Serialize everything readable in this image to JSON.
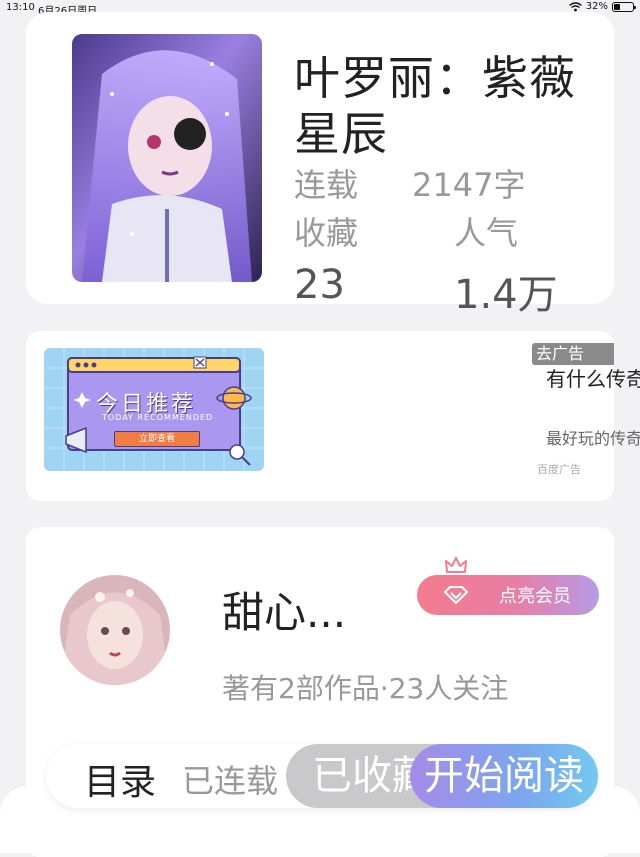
{
  "status_bar": {
    "time": "13:10",
    "date": "6月26日周日",
    "battery": "32%",
    "battery_level": 0.32,
    "wifi_icon": "wifi-icon"
  },
  "book": {
    "title": "叶罗丽：紫薇星辰",
    "status": "连载",
    "word_count": "2147字",
    "favorites_label": "收藏",
    "favorites_value": "23",
    "popularity_label": "人气",
    "popularity_value": "1.4万"
  },
  "ad": {
    "badge": "去广告",
    "title": "有什么传奇",
    "description": "最好玩的传奇",
    "source": "百度广告",
    "image_title": "今日推荐",
    "image_subtitle": "TODAY RECOMMENDED",
    "image_button": "立即查看"
  },
  "author": {
    "name": "甜心...",
    "member_button": "点亮会员",
    "info": "著有2部作品·23人关注"
  },
  "bottom_bar": {
    "catalog": "目录",
    "serial_status": "已连载",
    "collected": "已收藏",
    "start_reading": "开始阅读"
  },
  "colors": {
    "member_gradient_start": "#f47c8c",
    "member_gradient_end": "#b69be8",
    "read_gradient_start": "#a78ae8",
    "read_gradient_end": "#74c9f0",
    "collect_button": "#c9c9cb"
  }
}
